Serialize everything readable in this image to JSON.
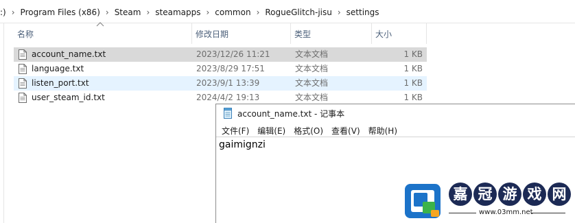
{
  "breadcrumb": {
    "items": [
      ":)",
      "Program Files (x86)",
      "Steam",
      "steamapps",
      "common",
      "RogueGlitch-jisu",
      "settings"
    ],
    "separator": "›"
  },
  "columns": {
    "name": "名称",
    "date": "修改日期",
    "type": "类型",
    "size": "大小"
  },
  "files": [
    {
      "name": "account_name.txt",
      "date": "2023/12/26 11:21",
      "type": "文本文档",
      "size": "1 KB",
      "state": "selected"
    },
    {
      "name": "language.txt",
      "date": "2023/8/29 17:51",
      "type": "文本文档",
      "size": "1 KB",
      "state": "normal"
    },
    {
      "name": "listen_port.txt",
      "date": "2023/9/1 13:39",
      "type": "文本文档",
      "size": "1 KB",
      "state": "hover"
    },
    {
      "name": "user_steam_id.txt",
      "date": "2024/4/2 19:13",
      "type": "文本文档",
      "size": "1 KB",
      "state": "normal"
    }
  ],
  "notepad": {
    "title": "account_name.txt - 记事本",
    "menu": [
      "文件(F)",
      "编辑(E)",
      "格式(O)",
      "查看(V)",
      "帮助(H)"
    ],
    "content": "gaimignzi"
  },
  "watermark": {
    "chars": [
      "嘉",
      "冠",
      "游",
      "戏",
      "网"
    ],
    "url": "www.03mm.net"
  },
  "colors": {
    "selected_row": "#d9d9d9",
    "hover_row": "#e5f3ff",
    "header_text": "#4c607a",
    "watermark_dark": "#1c2a55"
  }
}
